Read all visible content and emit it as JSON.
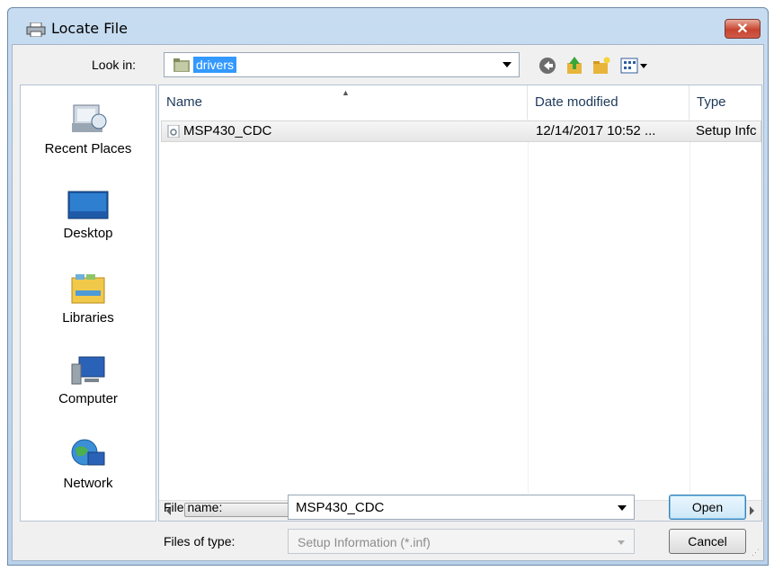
{
  "window": {
    "title": "Locate File",
    "close_label": "✕"
  },
  "toolbar": {
    "look_in_label": "Look in:",
    "look_in_value": "drivers",
    "buttons": [
      "back-icon",
      "up-folder-icon",
      "new-folder-icon",
      "view-menu-icon"
    ]
  },
  "sidebar": {
    "items": [
      {
        "label": "Recent Places",
        "icon": "recent-places-icon"
      },
      {
        "label": "Desktop",
        "icon": "desktop-icon"
      },
      {
        "label": "Libraries",
        "icon": "libraries-icon"
      },
      {
        "label": "Computer",
        "icon": "computer-icon"
      },
      {
        "label": "Network",
        "icon": "network-icon"
      }
    ]
  },
  "filelist": {
    "columns": [
      "Name",
      "Date modified",
      "Type"
    ],
    "rows": [
      {
        "name": "MSP430_CDC",
        "date": "12/14/2017 10:52 ...",
        "type": "Setup Infc"
      }
    ],
    "scroll_thumb_glyph": "III"
  },
  "footer": {
    "file_name_label": "File name:",
    "file_name_value": "MSP430_CDC",
    "file_type_label": "Files of type:",
    "file_type_value": "Setup Information (*.inf)",
    "open_label": "Open",
    "cancel_label": "Cancel"
  },
  "colors": {
    "titlebar": "#c7dcf1",
    "selection": "#3399ff",
    "close": "#c7452f"
  }
}
